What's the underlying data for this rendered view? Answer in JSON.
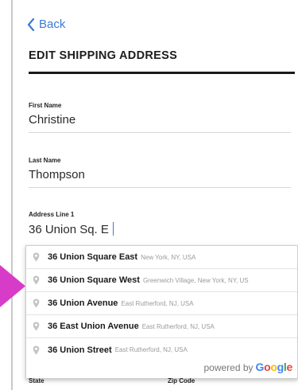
{
  "nav": {
    "back_label": "Back"
  },
  "header": {
    "title": "EDIT SHIPPING ADDRESS"
  },
  "form": {
    "first_name": {
      "label": "First Name",
      "value": "Christine"
    },
    "last_name": {
      "label": "Last Name",
      "value": "Thompson"
    },
    "address_line_1": {
      "label": "Address Line 1",
      "value": "36 Union Sq. E"
    },
    "state": {
      "label": "State"
    },
    "zip_code": {
      "label": "Zip Code"
    }
  },
  "suggestions": [
    {
      "main": "36 Union Square East",
      "secondary": "New York, NY, USA"
    },
    {
      "main": "36 Union Square West",
      "secondary": "Greenwich Village, New York, NY, US"
    },
    {
      "main": "36 Union Avenue",
      "secondary": "East Rutherford, NJ, USA"
    },
    {
      "main": "36 East Union Avenue",
      "secondary": "East Rutherford, NJ, USA"
    },
    {
      "main": "36 Union Street",
      "secondary": "East Rutherford, NJ, USA"
    }
  ],
  "attribution": {
    "prefix": "powered by",
    "brand": [
      "G",
      "o",
      "o",
      "g",
      "l",
      "e"
    ]
  },
  "colors": {
    "accent": "#3a7bd5",
    "pointer_arrow": "#d63cc8"
  },
  "icons": {
    "back": "chevron-left-icon",
    "suggestion": "map-pin-icon",
    "pointer": "arrow-right-icon"
  }
}
